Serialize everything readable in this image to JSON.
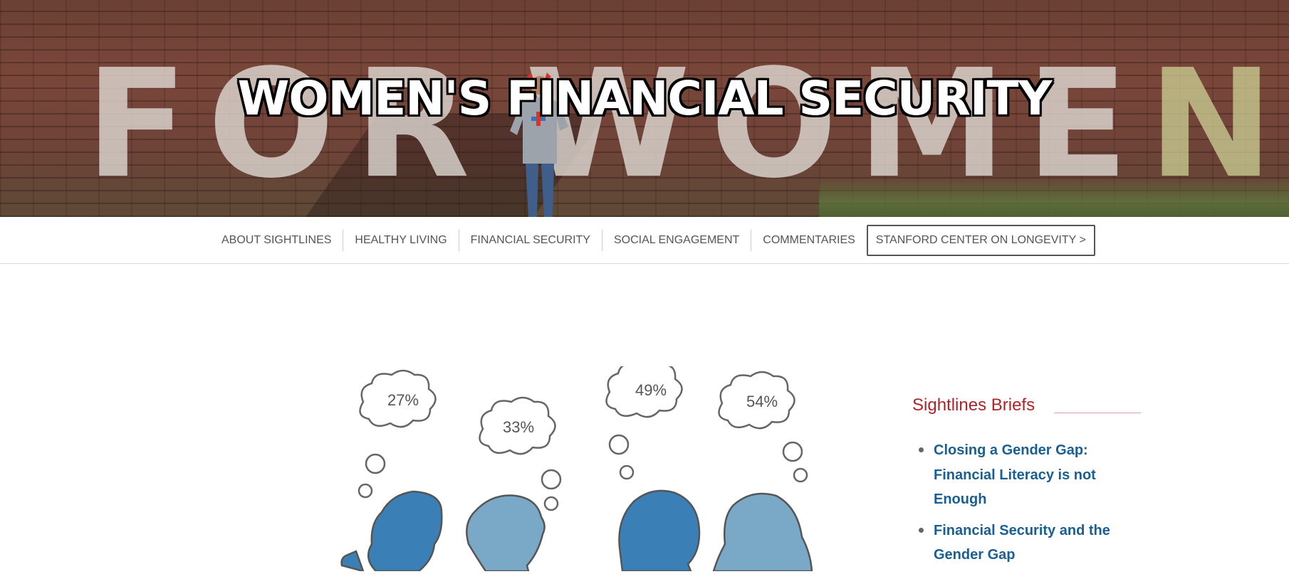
{
  "hero": {
    "title": "WOMEN'S FINANCIAL SECURITY",
    "wall_text_left": "FOR",
    "wall_text_right": "WOME",
    "wall_text_last": "N"
  },
  "nav": {
    "items": [
      {
        "label": "ABOUT SIGHTLINES"
      },
      {
        "label": "HEALTHY LIVING"
      },
      {
        "label": "FINANCIAL SECURITY"
      },
      {
        "label": "SOCIAL ENGAGEMENT"
      },
      {
        "label": "COMMENTARIES"
      }
    ],
    "external_link": "STANFORD CENTER ON LONGEVITY >"
  },
  "illustration": {
    "bubbles": [
      "27%",
      "33%",
      "49%",
      "54%"
    ],
    "colors": {
      "dark_blue": "#3a7fb5",
      "light_blue": "#7aa9c8",
      "outline": "#555555"
    }
  },
  "sidebar": {
    "heading": "Sightlines Briefs",
    "briefs": [
      {
        "title": "Closing a Gender Gap: Financial Literacy is not Enough"
      },
      {
        "title": "Financial Security and the Gender Gap"
      }
    ]
  },
  "colors": {
    "heading_red": "#b0232a",
    "link_blue": "#1a5f94",
    "nav_text": "#555555"
  }
}
